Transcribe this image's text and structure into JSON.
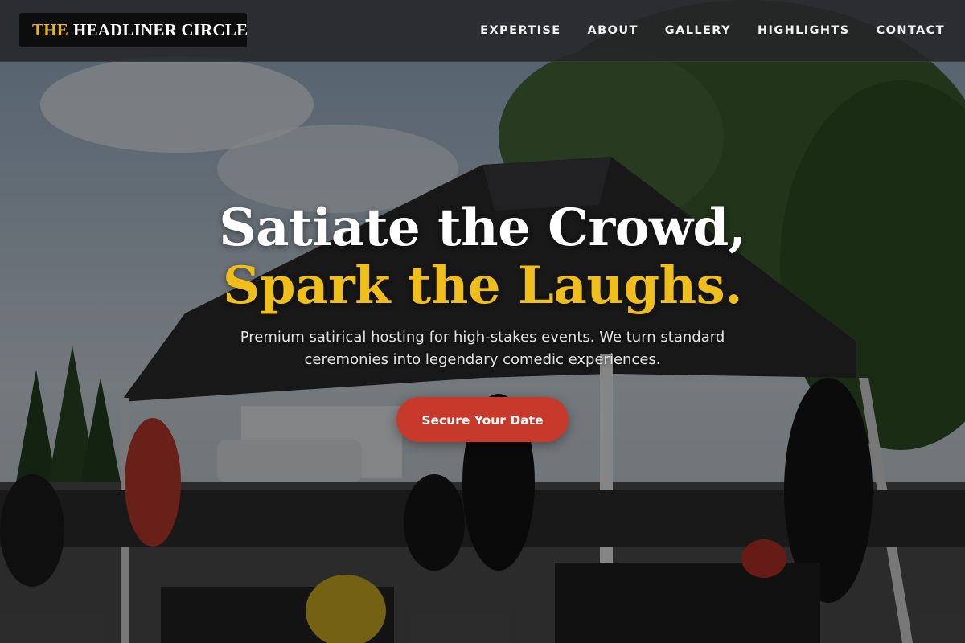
{
  "brand": {
    "accent": "THE",
    "name": "HEADLINER CIRCLE"
  },
  "nav": {
    "items": [
      {
        "label": "EXPERTISE"
      },
      {
        "label": "ABOUT"
      },
      {
        "label": "GALLERY"
      },
      {
        "label": "HIGHLIGHTS"
      },
      {
        "label": "CONTACT"
      }
    ]
  },
  "hero": {
    "headline_line1": "Satiate the Crowd,",
    "headline_line2": "Spark the Laughs.",
    "subtext": "Premium satirical hosting for high-stakes events. We turn standard ceremonies into legendary comedic experiences.",
    "cta_label": "Secure Your Date"
  },
  "colors": {
    "accent_gold": "#f0be1a",
    "cta_red": "#c73a2b",
    "nav_bg": "#262628"
  }
}
